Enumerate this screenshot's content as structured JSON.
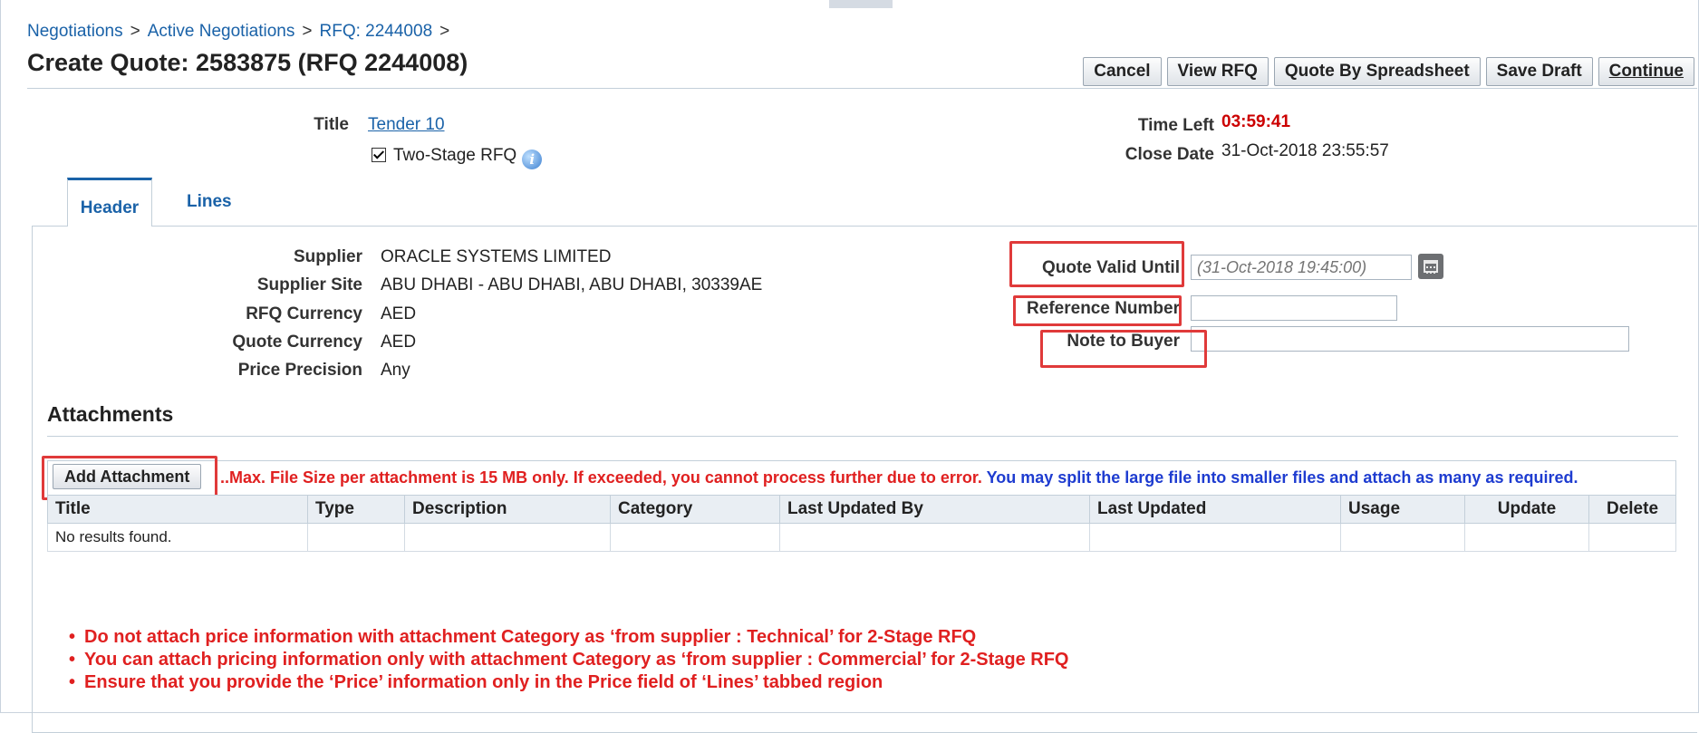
{
  "breadcrumb": {
    "items": [
      "Negotiations",
      "Active Negotiations",
      "RFQ: 2244008"
    ]
  },
  "page": {
    "title": "Create Quote: 2583875 (RFQ 2244008)"
  },
  "buttons": {
    "cancel": "Cancel",
    "view_rfq": "View RFQ",
    "quote_by_spreadsheet": "Quote By Spreadsheet",
    "save_draft": "Save Draft",
    "continue": "Continue"
  },
  "summary": {
    "title_label": "Title",
    "title_value": "Tender 10",
    "two_stage_label": "Two-Stage RFQ",
    "two_stage_checked": true,
    "time_left_label": "Time Left",
    "time_left_value": "03:59:41",
    "close_date_label": "Close Date",
    "close_date_value": "31-Oct-2018 23:55:57"
  },
  "tabs": [
    {
      "label": "Header",
      "active": true
    },
    {
      "label": "Lines",
      "active": false
    }
  ],
  "header": {
    "supplier_label": "Supplier",
    "supplier_value": "ORACLE SYSTEMS LIMITED",
    "supplier_site_label": "Supplier Site",
    "supplier_site_value": "ABU DHABI - ABU DHABI, ABU DHABI, 30339AE",
    "rfq_currency_label": "RFQ Currency",
    "rfq_currency_value": "AED",
    "quote_currency_label": "Quote Currency",
    "quote_currency_value": "AED",
    "price_precision_label": "Price Precision",
    "price_precision_value": "Any",
    "quote_valid_until_label": "Quote Valid Until",
    "quote_valid_until_placeholder": "(31-Oct-2018 19:45:00)",
    "reference_number_label": "Reference Number",
    "reference_number_value": "",
    "note_to_buyer_label": "Note to Buyer",
    "note_to_buyer_value": ""
  },
  "attachments": {
    "title": "Attachments",
    "add_button": "Add Attachment",
    "warning_red": "..Max. File Size per attachment is 15 MB only. If exceeded, you cannot process further due to error.",
    "warning_blue": "You may split the large file into smaller files and attach as many as required.",
    "columns": [
      "Title",
      "Type",
      "Description",
      "Category",
      "Last Updated By",
      "Last Updated",
      "Usage",
      "Update",
      "Delete"
    ],
    "empty_text": "No results found."
  },
  "notes": [
    "Do not attach price information with attachment Category as ‘from supplier : Technical’ for 2-Stage RFQ",
    "You can attach pricing information only with attachment Category as ‘from supplier : Commercial’ for 2-Stage RFQ",
    "Ensure that you provide the ‘Price’ information only in the Price field of ‘Lines’ tabbed region"
  ],
  "colors": {
    "link": "#1a62a8",
    "alert_red": "#e02020",
    "highlight_box": "#e03a3a",
    "info_blue": "#1e3cd0"
  },
  "icons": {
    "info": "info-icon",
    "calendar": "calendar-icon",
    "checkbox": "checkbox-checked"
  }
}
